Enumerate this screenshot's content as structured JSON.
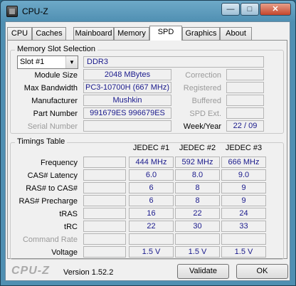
{
  "window": {
    "title": "CPU-Z",
    "controls": {
      "minimize": "—",
      "maximize": "□",
      "close": "✕"
    }
  },
  "tabs": [
    "CPU",
    "Caches",
    "Mainboard",
    "Memory",
    "SPD",
    "Graphics",
    "About"
  ],
  "active_tab": "SPD",
  "memory_slot": {
    "group_title": "Memory Slot Selection",
    "slot": "Slot #1",
    "type": "DDR3",
    "module_size_label": "Module Size",
    "module_size": "2048 MBytes",
    "max_bandwidth_label": "Max Bandwidth",
    "max_bandwidth": "PC3-10700H (667 MHz)",
    "manufacturer_label": "Manufacturer",
    "manufacturer": "Mushkin",
    "part_number_label": "Part Number",
    "part_number": "991679ES 996679ES",
    "serial_number_label": "Serial Number",
    "serial_number": "",
    "correction_label": "Correction",
    "correction": "",
    "registered_label": "Registered",
    "registered": "",
    "buffered_label": "Buffered",
    "buffered": "",
    "spd_ext_label": "SPD Ext.",
    "spd_ext": "",
    "week_year_label": "Week/Year",
    "week_year": "22 / 09"
  },
  "timings": {
    "group_title": "Timings Table",
    "columns": [
      "JEDEC #1",
      "JEDEC #2",
      "JEDEC #3",
      ""
    ],
    "rows": [
      {
        "label": "Frequency",
        "dim": false,
        "values": [
          "444 MHz",
          "592 MHz",
          "666 MHz",
          ""
        ]
      },
      {
        "label": "CAS# Latency",
        "dim": false,
        "values": [
          "6.0",
          "8.0",
          "9.0",
          ""
        ]
      },
      {
        "label": "RAS# to CAS#",
        "dim": false,
        "values": [
          "6",
          "8",
          "9",
          ""
        ]
      },
      {
        "label": "RAS# Precharge",
        "dim": false,
        "values": [
          "6",
          "8",
          "9",
          ""
        ]
      },
      {
        "label": "tRAS",
        "dim": false,
        "values": [
          "16",
          "22",
          "24",
          ""
        ]
      },
      {
        "label": "tRC",
        "dim": false,
        "values": [
          "22",
          "30",
          "33",
          ""
        ]
      },
      {
        "label": "Command Rate",
        "dim": true,
        "values": [
          "",
          "",
          "",
          ""
        ]
      },
      {
        "label": "Voltage",
        "dim": false,
        "values": [
          "1.5 V",
          "1.5 V",
          "1.5 V",
          ""
        ]
      }
    ]
  },
  "footer": {
    "logo": "CPU-Z",
    "version": "Version 1.52.2",
    "validate_label": "Validate",
    "ok_label": "OK"
  }
}
